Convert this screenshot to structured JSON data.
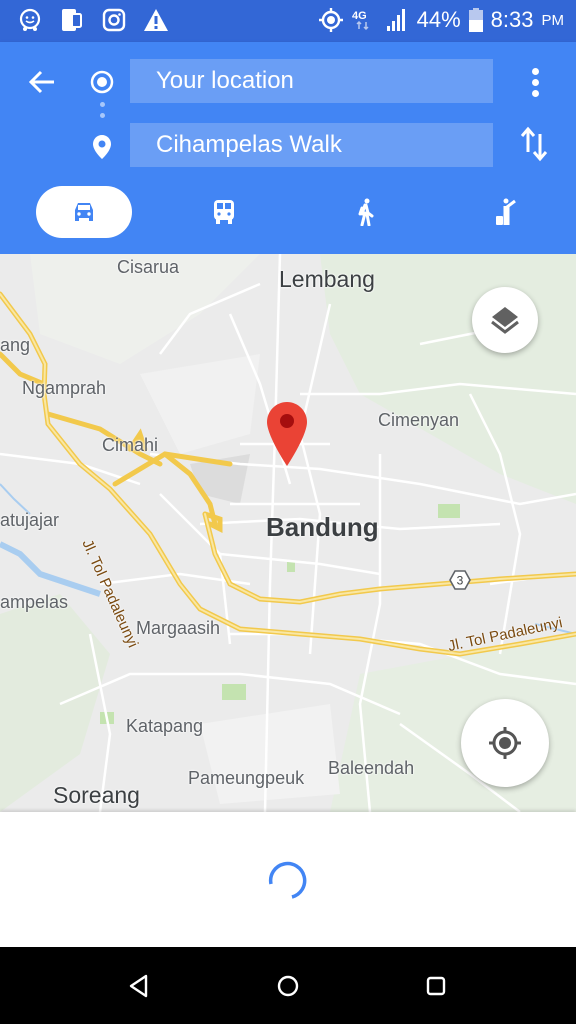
{
  "status_bar": {
    "left_icons": [
      "waze-icon",
      "phone-icon",
      "instagram-icon",
      "warning-icon"
    ],
    "right_icons": [
      "location-icon",
      "network-4g-icon",
      "signal-icon",
      "battery-icon"
    ],
    "network_type": "4G",
    "battery_percent": "44%",
    "battery_level": 0.44,
    "time": "8:33",
    "ampm": "PM"
  },
  "header": {
    "origin_value": "Your location",
    "destination_value": "Cihampelas Walk",
    "icons": {
      "back": "arrow-left-icon",
      "origin": "my-location-dot-icon",
      "destination": "place-pin-icon",
      "more": "more-vert-icon",
      "swap": "swap-vert-icon"
    },
    "travel_modes": [
      {
        "mode": "drive",
        "icon": "car-icon",
        "selected": true
      },
      {
        "mode": "transit",
        "icon": "bus-icon",
        "selected": false
      },
      {
        "mode": "walk",
        "icon": "walk-icon",
        "selected": false
      },
      {
        "mode": "ride",
        "icon": "ride-hailing-icon",
        "selected": false
      }
    ],
    "accent_color": "#4285f4"
  },
  "map": {
    "places": {
      "cisarua": "Cisarua",
      "lembang": "Lembang",
      "ang": "ang",
      "ngamprah": "Ngamprah",
      "cimenyan": "Cimenyan",
      "cimahi": "Cimahi",
      "atujajar": "atujajar",
      "bandung": "Bandung",
      "ampelas": "ampelas",
      "margaasih": "Margaasih",
      "katapang": "Katapang",
      "pameungpeuk": "Pameungpeuk",
      "baleendah": "Baleendah",
      "soreang": "Soreang"
    },
    "roads": {
      "toll_vertical": "Jl. Tol Padaleunyi",
      "toll_horizontal": "Jl. Tol Padaleunyi",
      "route_shield": "3"
    },
    "controls": {
      "layers": "layers-icon",
      "my_location": "gps-fixed-icon"
    },
    "pin_color": "#ea4335"
  },
  "bottom_sheet": {
    "loading": true
  },
  "nav_bar": {
    "buttons": [
      "back-triangle-icon",
      "home-circle-icon",
      "recents-square-icon"
    ]
  }
}
